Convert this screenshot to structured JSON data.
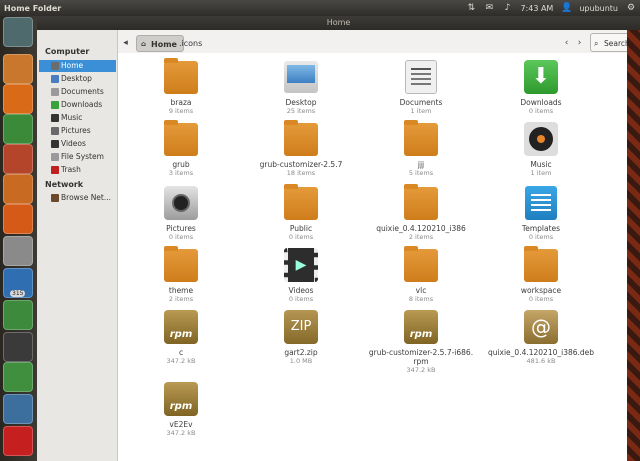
{
  "topbar": {
    "app_title": "Home Folder",
    "time": "7:43 AM",
    "user": "upubuntu",
    "icons": [
      "network-icon",
      "mail-icon",
      "volume-icon",
      "gear-icon"
    ]
  },
  "window": {
    "title": "Home"
  },
  "launcher": {
    "items": [
      {
        "name": "dash-icon",
        "color": "#4f6a6d"
      },
      {
        "name": "files-icon",
        "color": "#c9772d"
      },
      {
        "name": "firefox-icon",
        "color": "#d86a18"
      },
      {
        "name": "libreoffice-calc-icon",
        "color": "#3a8a3a"
      },
      {
        "name": "libreoffice-impress-icon",
        "color": "#b5452a"
      },
      {
        "name": "software-center-icon",
        "color": "#c96a22"
      },
      {
        "name": "ubuntu-one-icon",
        "color": "#d55a18"
      },
      {
        "name": "drive-icon",
        "color": "#8a8a8a"
      },
      {
        "name": "libreoffice-writer-icon",
        "color": "#2f6eb0"
      },
      {
        "name": "update-manager-icon",
        "color": "#3d8a3d"
      },
      {
        "name": "terminal-icon",
        "color": "#3a3a3a"
      },
      {
        "name": "system-monitor-icon",
        "color": "#3f8f3f"
      },
      {
        "name": "workspaces-icon",
        "color": "#3d6f9e"
      },
      {
        "name": "trash-icon",
        "color": "#c51f1f"
      }
    ],
    "badge": "315"
  },
  "sidebar": {
    "computer_heading": "Computer",
    "items": [
      {
        "label": "Home",
        "icon": "home-icon",
        "color": "#6c6c6c"
      },
      {
        "label": "Desktop",
        "icon": "desktop-icon",
        "color": "#4a7cc2"
      },
      {
        "label": "Documents",
        "icon": "documents-icon",
        "color": "#9a9a9a"
      },
      {
        "label": "Downloads",
        "icon": "downloads-icon",
        "color": "#3aa23a"
      },
      {
        "label": "Music",
        "icon": "music-icon",
        "color": "#333333"
      },
      {
        "label": "Pictures",
        "icon": "pictures-icon",
        "color": "#6a6a6a"
      },
      {
        "label": "Videos",
        "icon": "videos-icon",
        "color": "#333333"
      },
      {
        "label": "File System",
        "icon": "drive-icon",
        "color": "#9a9a9a"
      },
      {
        "label": "Trash",
        "icon": "trash-icon",
        "color": "#c02020"
      }
    ],
    "network_heading": "Network",
    "network_items": [
      {
        "label": "Browse Net...",
        "icon": "network-icon",
        "color": "#6a4a2a"
      }
    ]
  },
  "path": {
    "home": "Home",
    "current": ".icons"
  },
  "search_label": "Search",
  "files": [
    {
      "name": "braza",
      "meta": "9 items",
      "type": "folder"
    },
    {
      "name": "Desktop",
      "meta": "25 items",
      "type": "desktop"
    },
    {
      "name": "Documents",
      "meta": "1 item",
      "type": "documents"
    },
    {
      "name": "Downloads",
      "meta": "0 items",
      "type": "downloads"
    },
    {
      "name": "grub",
      "meta": "3 items",
      "type": "folder"
    },
    {
      "name": "grub-customizer-2.5.7",
      "meta": "18 items",
      "type": "folder"
    },
    {
      "name": "jjj",
      "meta": "5 items",
      "type": "folder"
    },
    {
      "name": "Music",
      "meta": "1 item",
      "type": "music"
    },
    {
      "name": "Pictures",
      "meta": "0 items",
      "type": "pictures"
    },
    {
      "name": "Public",
      "meta": "0 items",
      "type": "folder"
    },
    {
      "name": "quixie_0.4.120210_i386",
      "meta": "2 items",
      "type": "folder"
    },
    {
      "name": "Templates",
      "meta": "0 items",
      "type": "templates"
    },
    {
      "name": "theme",
      "meta": "2 items",
      "type": "folder"
    },
    {
      "name": "Videos",
      "meta": "0 items",
      "type": "videos"
    },
    {
      "name": "vlc",
      "meta": "8 items",
      "type": "folder"
    },
    {
      "name": "workspace",
      "meta": "0 items",
      "type": "folder"
    },
    {
      "name": "c",
      "meta": "347.2 kB",
      "type": "rpm"
    },
    {
      "name": "gart2.zip",
      "meta": "1.0 MB",
      "type": "zip"
    },
    {
      "name": "grub-customizer-2.5.7-i686.\nrpm",
      "meta": "347.2 kB",
      "type": "rpm"
    },
    {
      "name": "quixie_0.4.120210_i386.deb",
      "meta": "481.6 kB",
      "type": "deb"
    },
    {
      "name": "vE2Ev",
      "meta": "347.2 kB",
      "type": "rpm"
    }
  ]
}
